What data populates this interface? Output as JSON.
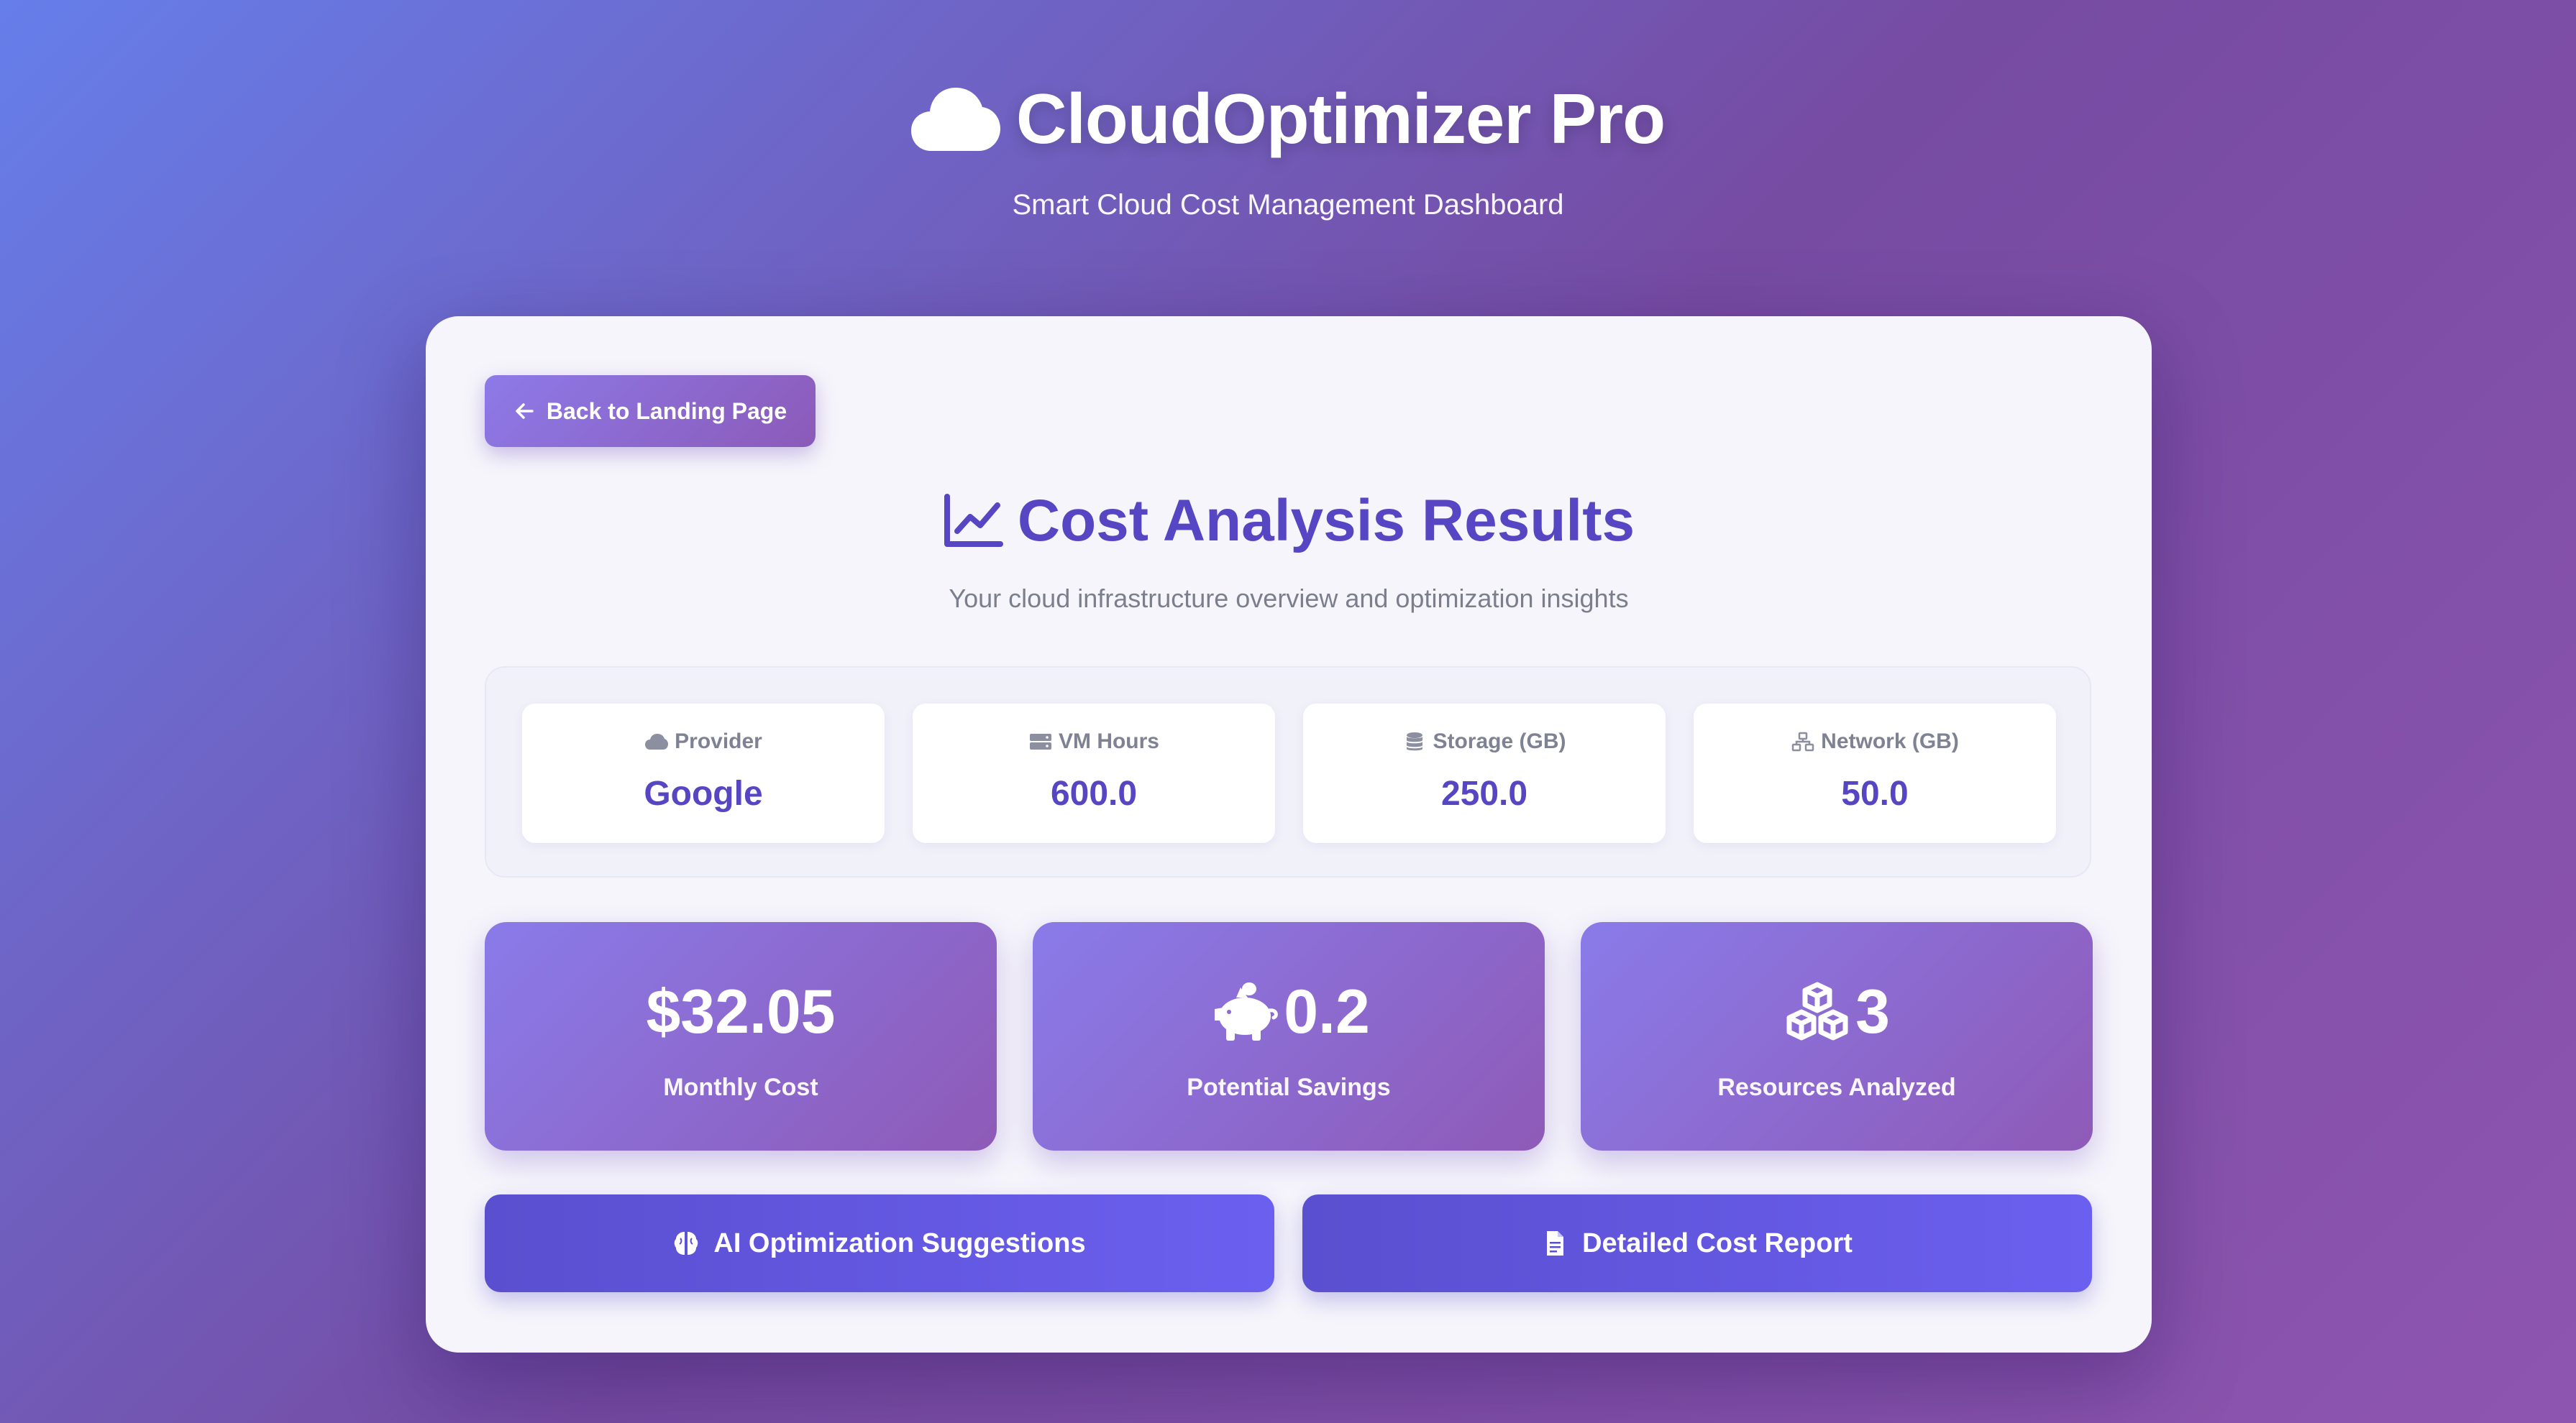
{
  "header": {
    "title": "CloudOptimizer Pro",
    "title_icon": "cloud-icon",
    "subtitle": "Smart Cloud Cost Management Dashboard"
  },
  "card": {
    "back_button": {
      "label": "Back to Landing Page",
      "icon": "arrow-left-icon"
    },
    "title": "Cost Analysis Results",
    "title_icon": "chart-line-icon",
    "subtitle": "Your cloud infrastructure overview and optimization insights",
    "stats": [
      {
        "label": "Provider",
        "value": "Google",
        "icon": "cloud-icon"
      },
      {
        "label": "VM Hours",
        "value": "600.0",
        "icon": "server-icon"
      },
      {
        "label": "Storage (GB)",
        "value": "250.0",
        "icon": "database-icon"
      },
      {
        "label": "Network (GB)",
        "value": "50.0",
        "icon": "network-icon"
      }
    ],
    "metrics": [
      {
        "value": "$32.05",
        "label": "Monthly Cost",
        "icon": ""
      },
      {
        "value": "0.2",
        "label": "Potential Savings",
        "icon": "piggy-bank-icon"
      },
      {
        "value": "3",
        "label": "Resources Analyzed",
        "icon": "cubes-icon"
      }
    ],
    "actions": [
      {
        "label": "AI Optimization Suggestions",
        "icon": "brain-icon"
      },
      {
        "label": "Detailed Cost Report",
        "icon": "file-icon"
      }
    ]
  },
  "colors": {
    "background_start": "#667eea",
    "background_end": "#764ba2",
    "accent": "#5646c3",
    "card_background": "#f6f5fb",
    "action_button": "#6b5ff0"
  }
}
